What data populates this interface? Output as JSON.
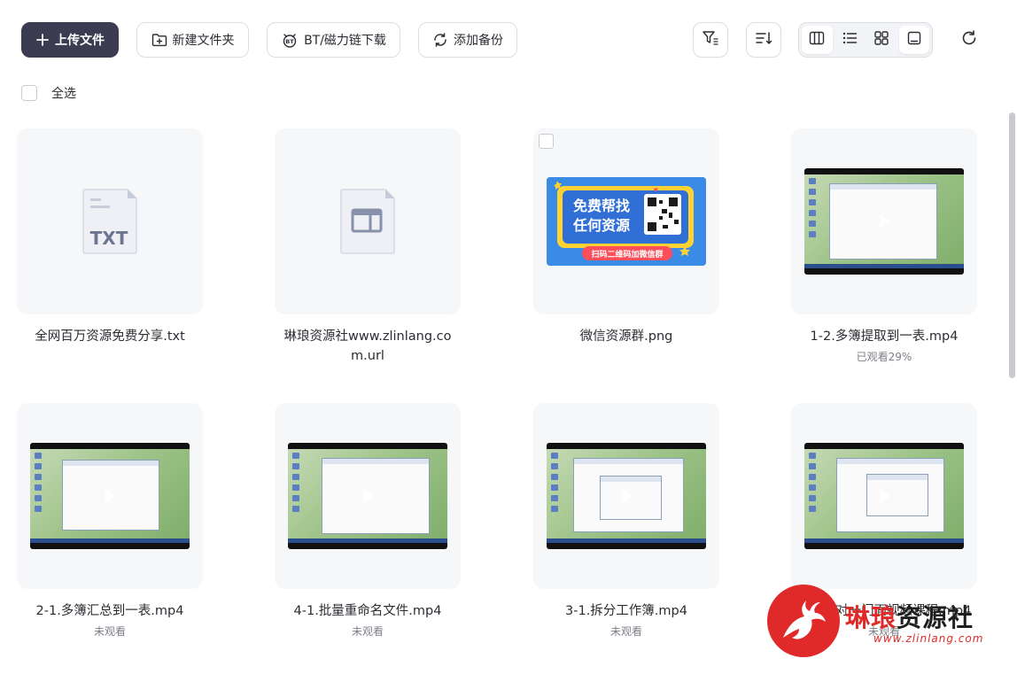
{
  "toolbar": {
    "upload_label": "上传文件",
    "new_folder_label": "新建文件夹",
    "bt_label": "BT/磁力链下载",
    "backup_label": "添加备份",
    "bt_icon_text": "BT"
  },
  "select_all_label": "全选",
  "files": [
    {
      "name": "全网百万资源免费分享.txt",
      "meta": "",
      "type": "txt",
      "badge": "TXT"
    },
    {
      "name": "琳琅资源社www.zlinlang.com.url",
      "meta": "",
      "type": "url"
    },
    {
      "name": "微信资源群.png",
      "meta": "",
      "type": "image",
      "promo": {
        "line1": "免费帮找",
        "line2": "任何资源",
        "button": "扫码二维码加微信群"
      }
    },
    {
      "name": "1-2.多簿提取到一表.mp4",
      "meta": "已观看29%",
      "type": "video"
    },
    {
      "name": "2-1.多簿汇总到一表.mp4",
      "meta": "未观看",
      "type": "video"
    },
    {
      "name": "4-1.批量重命名文件.mp4",
      "meta": "未观看",
      "type": "video"
    },
    {
      "name": "3-1.拆分工作簿.mp4",
      "meta": "未观看",
      "type": "video"
    },
    {
      "name": "导师一对一门面视频课程.mp4",
      "meta": "未观看",
      "type": "video"
    }
  ],
  "watermark": {
    "part1": "琳琅",
    "part2": "资源社",
    "url": "www.zlinlang.com"
  },
  "colors": {
    "primary": "#3b3c52",
    "card_bg": "#f6f7f9",
    "watermark_red": "#e02a2a",
    "promo_blue": "#3a8be6",
    "promo_yellow": "#ffd233"
  }
}
